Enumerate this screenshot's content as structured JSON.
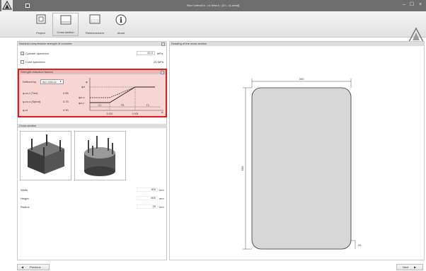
{
  "window": {
    "title": "Sika CarboDur - v1.beta.0 - [D:\\...\\4-axis8]",
    "min_symbol": "–",
    "max_symbol": "☐",
    "close_symbol": "×"
  },
  "ribbon": {
    "tabs": [
      {
        "label": "Project"
      },
      {
        "label": "Cross section"
      },
      {
        "label": "Reinforcement"
      },
      {
        "label": "About"
      }
    ],
    "brand_text": "BUILDING TRUST"
  },
  "concrete": {
    "title": "Nominal compressive strength of concrete",
    "collapse_label": "«",
    "cylinder_label": "Cylinder specimen",
    "cylinder_checked": true,
    "cylinder_value": "20.0",
    "cylinder_unit": "MPa",
    "cube_label": "Cube specimen",
    "cube_checked": false,
    "cube_value": "25 MPa"
  },
  "srf": {
    "title": "Strength reduction factors",
    "collapse_label": "«",
    "defined_by_label": "Defined by",
    "defined_by_value": "ACI 318-11",
    "rows": [
      {
        "label": "φ-cc,t (Tied)",
        "value": "0.65"
      },
      {
        "label": "φ-cc,s (Spiral)",
        "value": "0.75"
      },
      {
        "label": "φ-ct",
        "value": "0.90"
      }
    ],
    "graph": {
      "phi": "φ",
      "phi_ct": "φct",
      "phi_ccs": "φcc,s",
      "phi_cct": "φcc,t",
      "zone_cc": "CC",
      "zone_tr": "TR",
      "zone_tc": "TC",
      "x1": "0.002",
      "x2": "0.005",
      "eps": "εt"
    }
  },
  "cross_section": {
    "title": "Cross section"
  },
  "dims": [
    {
      "label": "Width",
      "value": "300",
      "unit": "mm"
    },
    {
      "label": "Height",
      "value": "500",
      "unit": "mm"
    },
    {
      "label": "Radius",
      "value": "25",
      "unit": "mm"
    }
  ],
  "drawing": {
    "title": "Drawing of the cross section",
    "width_dim": "300",
    "height_dim": "500",
    "radius_dim": "25"
  },
  "nav": {
    "previous": "Previous",
    "next": "Next"
  },
  "colors": {
    "highlight_border": "#e01b1b",
    "highlight_fill": "#f7d5d5",
    "section_fill": "#d7d7d7"
  }
}
